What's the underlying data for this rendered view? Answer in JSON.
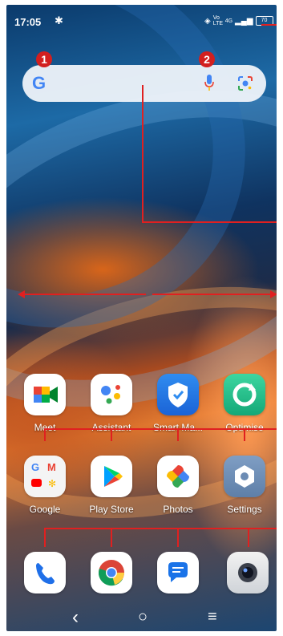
{
  "status_bar": {
    "time": "17:05",
    "settings_icon": "gear-icon",
    "network_label": "Vo LTE",
    "network_type": "4G",
    "battery": "70"
  },
  "search_bar": {
    "logo": "G",
    "mic_icon": "mic-icon",
    "lens_icon": "lens-icon"
  },
  "annotations": {
    "badge_1": "1",
    "badge_2": "2",
    "color": "#e02020"
  },
  "apps_row1": [
    {
      "label": "Meet",
      "icon": "meet-icon"
    },
    {
      "label": "Assistant",
      "icon": "assistant-icon"
    },
    {
      "label": "Smart Ma...",
      "icon": "smart-manager-icon"
    },
    {
      "label": "Optimise",
      "icon": "optimise-icon"
    }
  ],
  "apps_row2": [
    {
      "label": "Google",
      "icon": "google-folder-icon"
    },
    {
      "label": "Play Store",
      "icon": "play-store-icon"
    },
    {
      "label": "Photos",
      "icon": "photos-icon"
    },
    {
      "label": "Settings",
      "icon": "settings-icon"
    }
  ],
  "dock": [
    {
      "name": "Phone",
      "icon": "phone-icon"
    },
    {
      "name": "Chrome",
      "icon": "chrome-icon"
    },
    {
      "name": "Messages",
      "icon": "messages-icon"
    },
    {
      "name": "Camera",
      "icon": "camera-icon"
    }
  ],
  "nav_bar": {
    "back": "‹",
    "home": "○",
    "recents": "≡"
  }
}
